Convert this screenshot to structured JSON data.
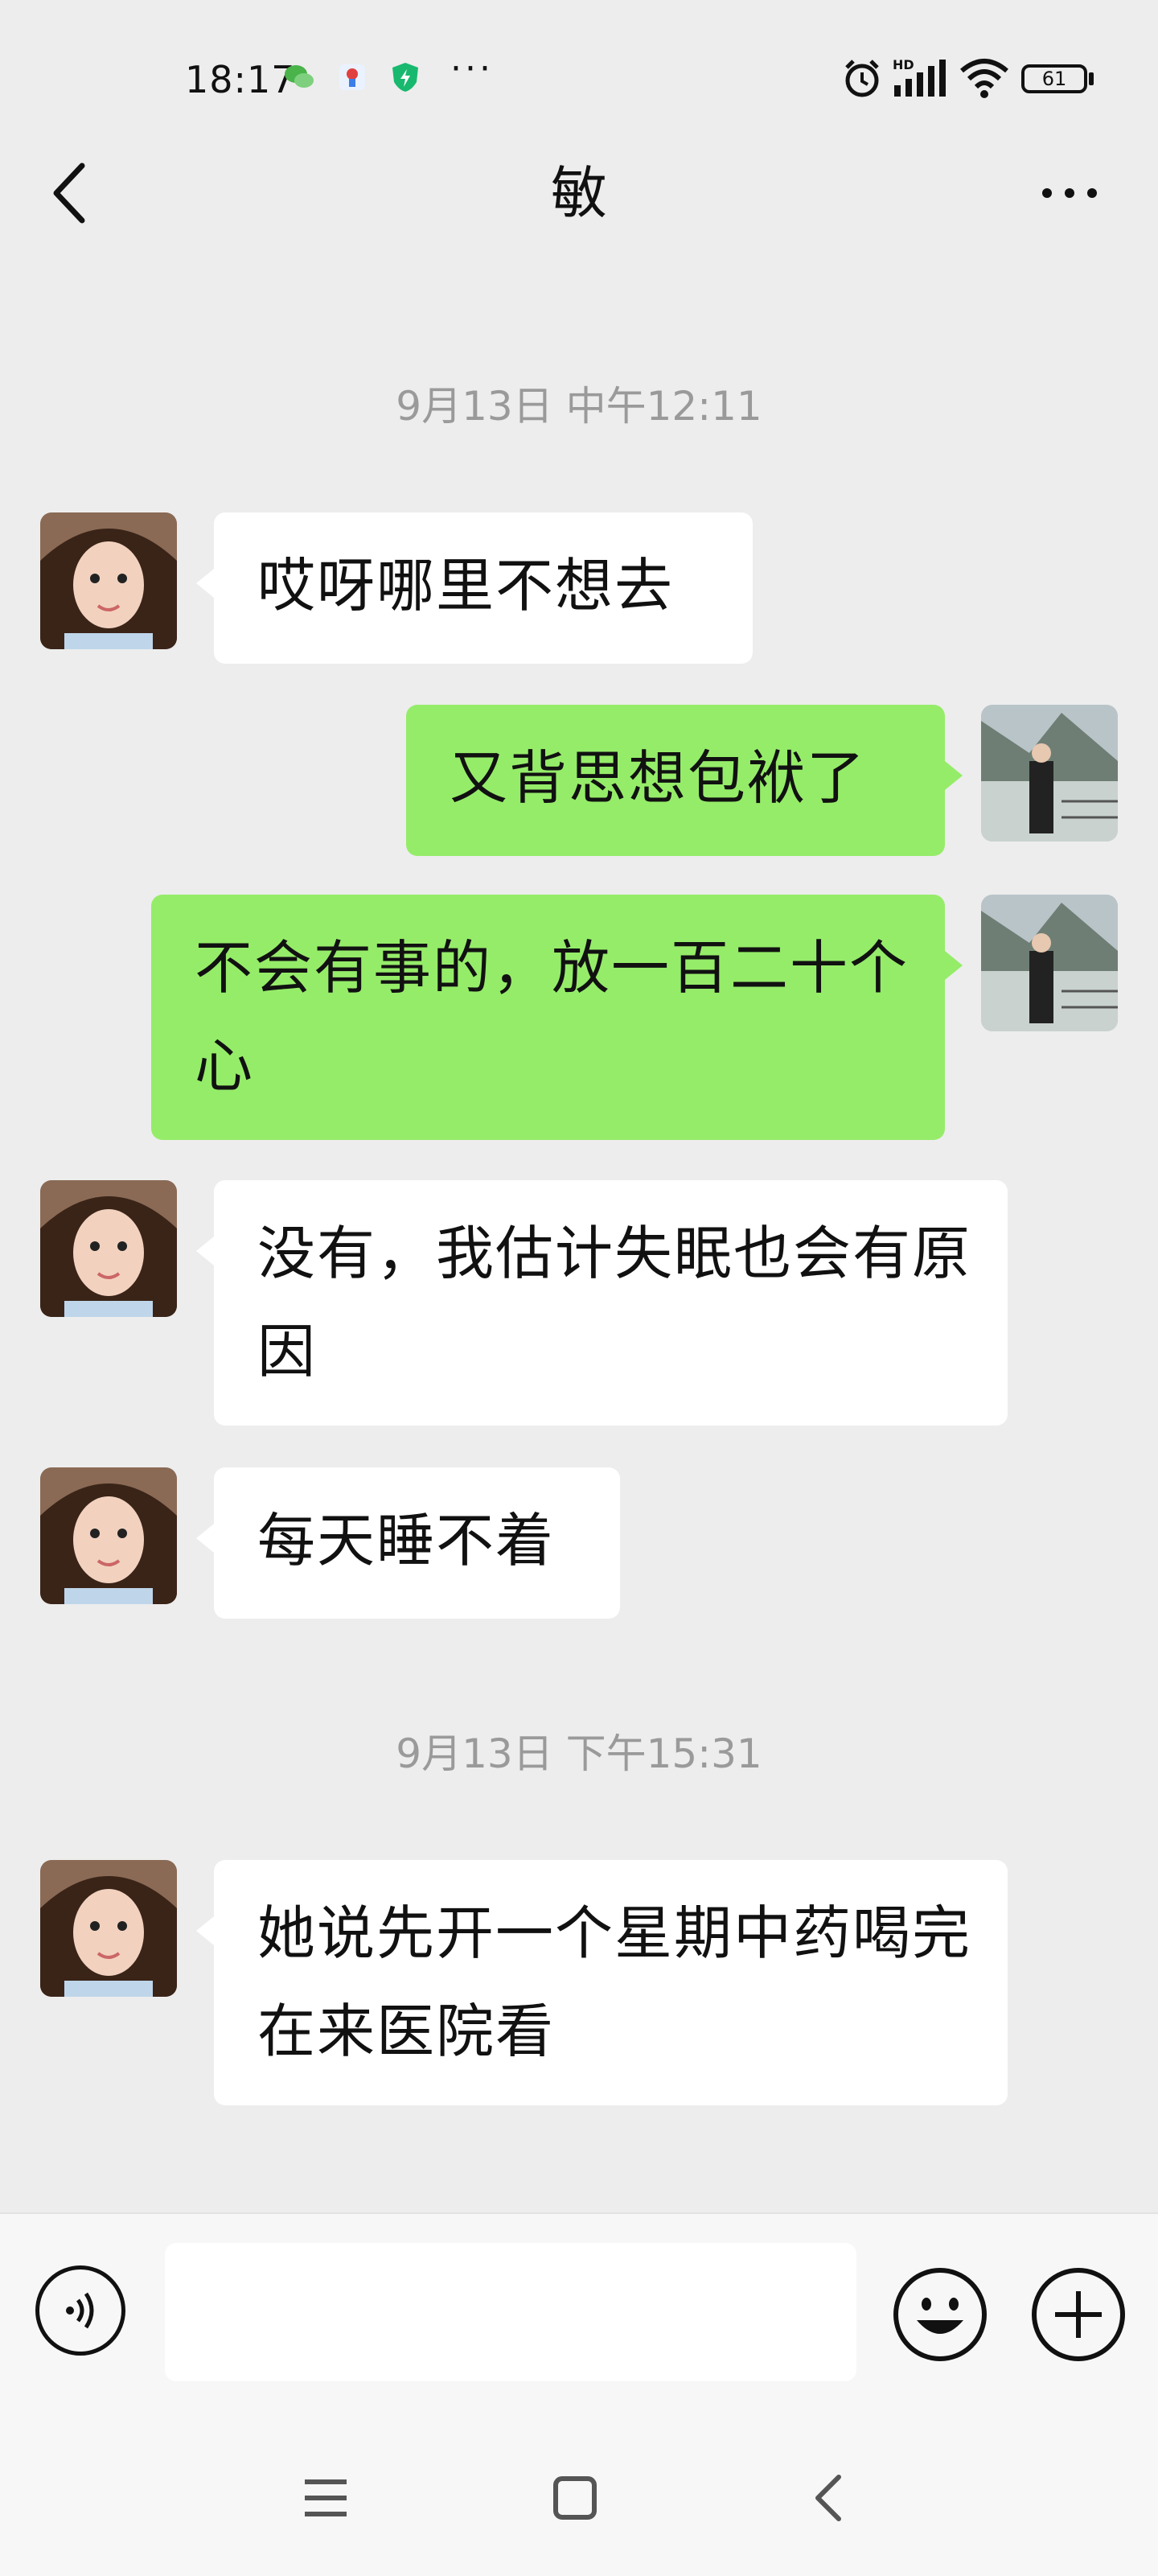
{
  "status_bar": {
    "time": "18:17",
    "battery": "61",
    "dots": "···"
  },
  "header": {
    "title": "敏"
  },
  "colors": {
    "background": "#ededed",
    "bubble_self": "#95ec69",
    "bubble_other": "#ffffff",
    "timestamp": "#9a9a9a"
  },
  "messages": [
    {
      "text": "哎呀哪里不想去"
    },
    {
      "text": "又背思想包袱了"
    },
    {
      "text": "不会有事的，放一百二十个心"
    },
    {
      "text": "没有，我估计失眠也会有原因"
    },
    {
      "text": "每天睡不着"
    },
    {
      "text": "她说先开一个星期中药喝完在来医院看"
    }
  ],
  "timestamps": [
    "9月13日 中午12:11",
    "9月13日 下午15:31"
  ],
  "input": {
    "placeholder": ""
  },
  "icons": [
    "back-icon",
    "more-icon",
    "voice-icon",
    "emoji-icon",
    "plus-icon",
    "menu-icon",
    "home-icon",
    "nav-back-icon"
  ]
}
